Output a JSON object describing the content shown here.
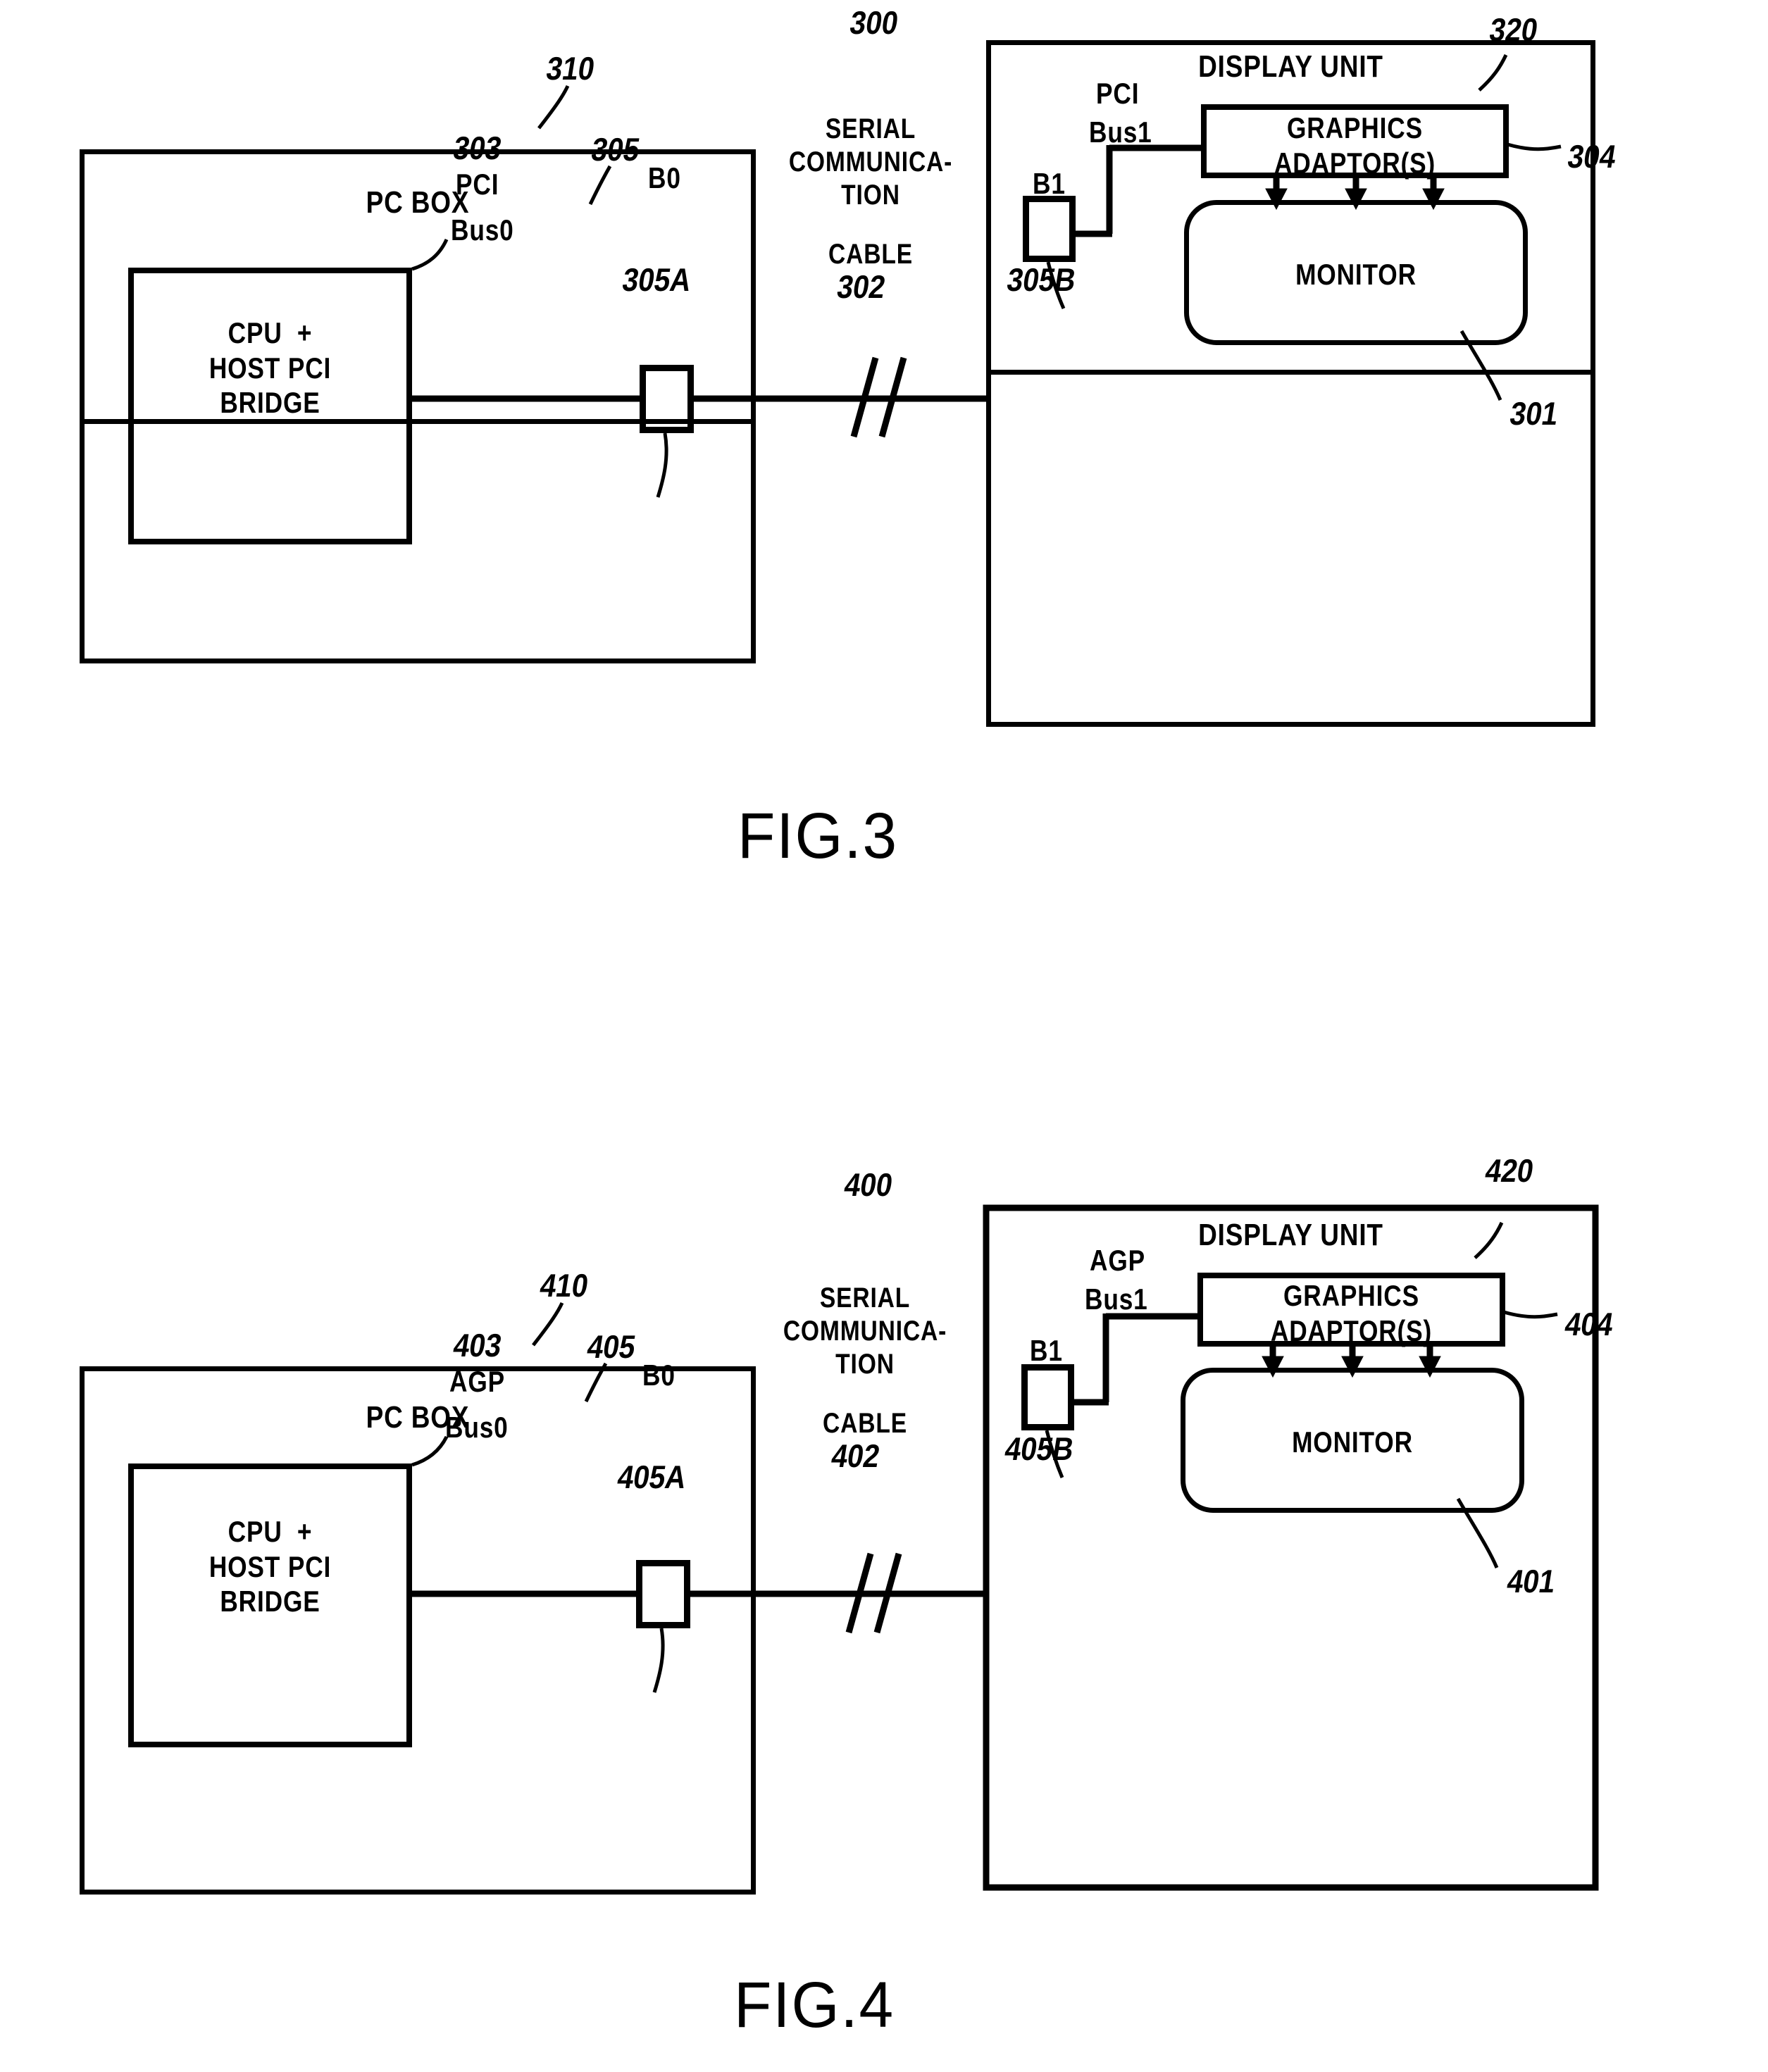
{
  "document": {
    "type": "patent-drawing-sheet",
    "figures": [
      "FIG.3",
      "FIG.4"
    ]
  },
  "fig3": {
    "figure_label": "FIG.3",
    "system_ref": "300",
    "pc_box": {
      "title": "PC BOX",
      "ref": "310",
      "bridge_label_line1": "CPU  +",
      "bridge_label_line2": "HOST PCI",
      "bridge_label_line3": "BRIDGE",
      "bridge_ref": "303",
      "bus_name_line1": "PCI",
      "bus_name_line2": "Bus0",
      "bus_ref": "305",
      "bridge_chip_label": "B0",
      "bridge_chip_ref": "305A"
    },
    "cable": {
      "line1": "SERIAL",
      "line2": "COMMUNICA-",
      "line3": "TION",
      "line4": "CABLE",
      "ref": "302"
    },
    "display_unit": {
      "title": "DISPLAY UNIT",
      "ref": "320",
      "bus_name_line1": "PCI",
      "bus_name_line2": "Bus1",
      "bridge_chip_label": "B1",
      "bridge_chip_ref": "305B",
      "adaptor_line1": "GRAPHICS",
      "adaptor_line2": "ADAPTOR(S)",
      "adaptor_ref": "304",
      "monitor_label": "MONITOR",
      "monitor_ref": "301",
      "arrow_count": 3
    }
  },
  "fig4": {
    "figure_label": "FIG.4",
    "system_ref": "400",
    "pc_box": {
      "title": "PC BOX",
      "ref": "410",
      "bridge_label_line1": "CPU  +",
      "bridge_label_line2": "HOST PCI",
      "bridge_label_line3": "BRIDGE",
      "bridge_ref": "403",
      "bus_name_line1": "AGP",
      "bus_name_line2": "Bus0",
      "bus_ref": "405",
      "bridge_chip_label": "B0",
      "bridge_chip_ref": "405A"
    },
    "cable": {
      "line1": "SERIAL",
      "line2": "COMMUNICA-",
      "line3": "TION",
      "line4": "CABLE",
      "ref": "402"
    },
    "display_unit": {
      "title": "DISPLAY UNIT",
      "ref": "420",
      "bus_name_line1": "AGP",
      "bus_name_line2": "Bus1",
      "bridge_chip_label": "B1",
      "bridge_chip_ref": "405B",
      "adaptor_line1": "GRAPHICS",
      "adaptor_line2": "ADAPTOR(S)",
      "adaptor_ref": "404",
      "monitor_label": "MONITOR",
      "monitor_ref": "401",
      "arrow_count": 3
    }
  },
  "colors": {
    "ink": "#000000",
    "paper": "#ffffff"
  }
}
